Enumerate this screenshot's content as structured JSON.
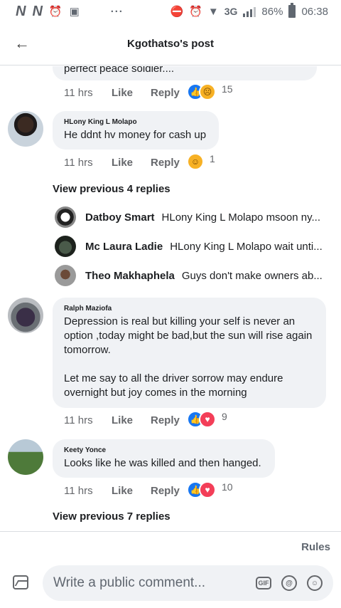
{
  "status_bar": {
    "left_icons": [
      "N",
      "N",
      "alarm-icon",
      "image-icon"
    ],
    "dots": "···",
    "network": "3G",
    "battery": "86%",
    "time": "06:38"
  },
  "header": {
    "back_icon": "←",
    "title": "Kgothatso's post"
  },
  "comments": [
    {
      "text_partial": "perfect peace soldier....",
      "time": "11 hrs",
      "like": "Like",
      "reply": "Reply",
      "reactions": [
        "like",
        "sad"
      ],
      "count": "15"
    },
    {
      "author": "HLony King L Molapo",
      "text": "He ddnt hv money for cash up",
      "time": "11 hrs",
      "like": "Like",
      "reply": "Reply",
      "reactions": [
        "haha"
      ],
      "count": "1",
      "view_previous": "View previous 4 replies",
      "replies": [
        {
          "name": "Datboy Smart",
          "text": "HLony King L Molapo msoon ny..."
        },
        {
          "name": "Mc Laura Ladie",
          "text": "HLony King L Molapo wait unti..."
        },
        {
          "name": "Theo Makhaphela",
          "text": "Guys don't make owners ab..."
        }
      ]
    },
    {
      "author": "Ralph Maziofa",
      "text_lines": [
        "Depression is real but killing your self is never an",
        "option ,today might be bad,but the sun will rise again",
        "tomorrow.",
        "",
        "Let me say to all the driver sorrow may endure",
        "overnight but joy comes in the morning"
      ],
      "time": "11 hrs",
      "like": "Like",
      "reply": "Reply",
      "reactions": [
        "like",
        "love"
      ],
      "count": "9"
    },
    {
      "author": "Keety Yonce",
      "text": "Looks like he was killed and then hanged.",
      "time": "11 hrs",
      "like": "Like",
      "reply": "Reply",
      "reactions": [
        "like",
        "love"
      ],
      "count": "10",
      "view_previous": "View previous 7 replies"
    }
  ],
  "footer": {
    "rules": "Rules",
    "composer_placeholder": "Write a public comment...",
    "gif_label": "GIF",
    "at_label": "@",
    "emoji_label": "☺"
  },
  "colors": {
    "like_blue": "#1877f2",
    "love_red": "#f33e58",
    "bubble_gray": "#f0f2f5",
    "meta_gray": "#65676b"
  }
}
